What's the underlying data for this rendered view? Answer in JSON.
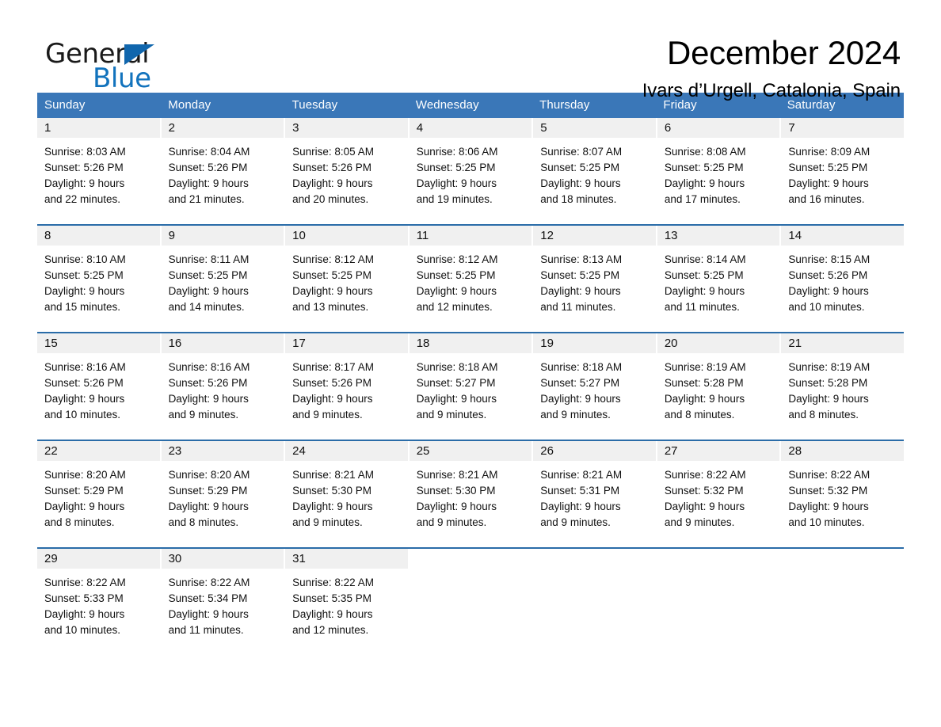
{
  "logo": {
    "word1": "General",
    "word2": "Blue",
    "triangle_color": "#1066ad",
    "blue_color": "#1273bd"
  },
  "header": {
    "title": "December 2024",
    "subtitle": "Ivars d’Urgell, Catalonia, Spain"
  },
  "calendar": {
    "header_color": "#3a77b8",
    "row_rule_color": "#2a6ca8",
    "daynum_band_color": "#f0f0f0",
    "weekdays": [
      "Sunday",
      "Monday",
      "Tuesday",
      "Wednesday",
      "Thursday",
      "Friday",
      "Saturday"
    ],
    "weeks": [
      [
        {
          "day": "1",
          "info": "Sunrise: 8:03 AM\nSunset: 5:26 PM\nDaylight: 9 hours\nand 22 minutes."
        },
        {
          "day": "2",
          "info": "Sunrise: 8:04 AM\nSunset: 5:26 PM\nDaylight: 9 hours\nand 21 minutes."
        },
        {
          "day": "3",
          "info": "Sunrise: 8:05 AM\nSunset: 5:26 PM\nDaylight: 9 hours\nand 20 minutes."
        },
        {
          "day": "4",
          "info": "Sunrise: 8:06 AM\nSunset: 5:25 PM\nDaylight: 9 hours\nand 19 minutes."
        },
        {
          "day": "5",
          "info": "Sunrise: 8:07 AM\nSunset: 5:25 PM\nDaylight: 9 hours\nand 18 minutes."
        },
        {
          "day": "6",
          "info": "Sunrise: 8:08 AM\nSunset: 5:25 PM\nDaylight: 9 hours\nand 17 minutes."
        },
        {
          "day": "7",
          "info": "Sunrise: 8:09 AM\nSunset: 5:25 PM\nDaylight: 9 hours\nand 16 minutes."
        }
      ],
      [
        {
          "day": "8",
          "info": "Sunrise: 8:10 AM\nSunset: 5:25 PM\nDaylight: 9 hours\nand 15 minutes."
        },
        {
          "day": "9",
          "info": "Sunrise: 8:11 AM\nSunset: 5:25 PM\nDaylight: 9 hours\nand 14 minutes."
        },
        {
          "day": "10",
          "info": "Sunrise: 8:12 AM\nSunset: 5:25 PM\nDaylight: 9 hours\nand 13 minutes."
        },
        {
          "day": "11",
          "info": "Sunrise: 8:12 AM\nSunset: 5:25 PM\nDaylight: 9 hours\nand 12 minutes."
        },
        {
          "day": "12",
          "info": "Sunrise: 8:13 AM\nSunset: 5:25 PM\nDaylight: 9 hours\nand 11 minutes."
        },
        {
          "day": "13",
          "info": "Sunrise: 8:14 AM\nSunset: 5:25 PM\nDaylight: 9 hours\nand 11 minutes."
        },
        {
          "day": "14",
          "info": "Sunrise: 8:15 AM\nSunset: 5:26 PM\nDaylight: 9 hours\nand 10 minutes."
        }
      ],
      [
        {
          "day": "15",
          "info": "Sunrise: 8:16 AM\nSunset: 5:26 PM\nDaylight: 9 hours\nand 10 minutes."
        },
        {
          "day": "16",
          "info": "Sunrise: 8:16 AM\nSunset: 5:26 PM\nDaylight: 9 hours\nand 9 minutes."
        },
        {
          "day": "17",
          "info": "Sunrise: 8:17 AM\nSunset: 5:26 PM\nDaylight: 9 hours\nand 9 minutes."
        },
        {
          "day": "18",
          "info": "Sunrise: 8:18 AM\nSunset: 5:27 PM\nDaylight: 9 hours\nand 9 minutes."
        },
        {
          "day": "19",
          "info": "Sunrise: 8:18 AM\nSunset: 5:27 PM\nDaylight: 9 hours\nand 9 minutes."
        },
        {
          "day": "20",
          "info": "Sunrise: 8:19 AM\nSunset: 5:28 PM\nDaylight: 9 hours\nand 8 minutes."
        },
        {
          "day": "21",
          "info": "Sunrise: 8:19 AM\nSunset: 5:28 PM\nDaylight: 9 hours\nand 8 minutes."
        }
      ],
      [
        {
          "day": "22",
          "info": "Sunrise: 8:20 AM\nSunset: 5:29 PM\nDaylight: 9 hours\nand 8 minutes."
        },
        {
          "day": "23",
          "info": "Sunrise: 8:20 AM\nSunset: 5:29 PM\nDaylight: 9 hours\nand 8 minutes."
        },
        {
          "day": "24",
          "info": "Sunrise: 8:21 AM\nSunset: 5:30 PM\nDaylight: 9 hours\nand 9 minutes."
        },
        {
          "day": "25",
          "info": "Sunrise: 8:21 AM\nSunset: 5:30 PM\nDaylight: 9 hours\nand 9 minutes."
        },
        {
          "day": "26",
          "info": "Sunrise: 8:21 AM\nSunset: 5:31 PM\nDaylight: 9 hours\nand 9 minutes."
        },
        {
          "day": "27",
          "info": "Sunrise: 8:22 AM\nSunset: 5:32 PM\nDaylight: 9 hours\nand 9 minutes."
        },
        {
          "day": "28",
          "info": "Sunrise: 8:22 AM\nSunset: 5:32 PM\nDaylight: 9 hours\nand 10 minutes."
        }
      ],
      [
        {
          "day": "29",
          "info": "Sunrise: 8:22 AM\nSunset: 5:33 PM\nDaylight: 9 hours\nand 10 minutes."
        },
        {
          "day": "30",
          "info": "Sunrise: 8:22 AM\nSunset: 5:34 PM\nDaylight: 9 hours\nand 11 minutes."
        },
        {
          "day": "31",
          "info": "Sunrise: 8:22 AM\nSunset: 5:35 PM\nDaylight: 9 hours\nand 12 minutes."
        },
        {
          "day": "",
          "info": ""
        },
        {
          "day": "",
          "info": ""
        },
        {
          "day": "",
          "info": ""
        },
        {
          "day": "",
          "info": ""
        }
      ]
    ]
  }
}
